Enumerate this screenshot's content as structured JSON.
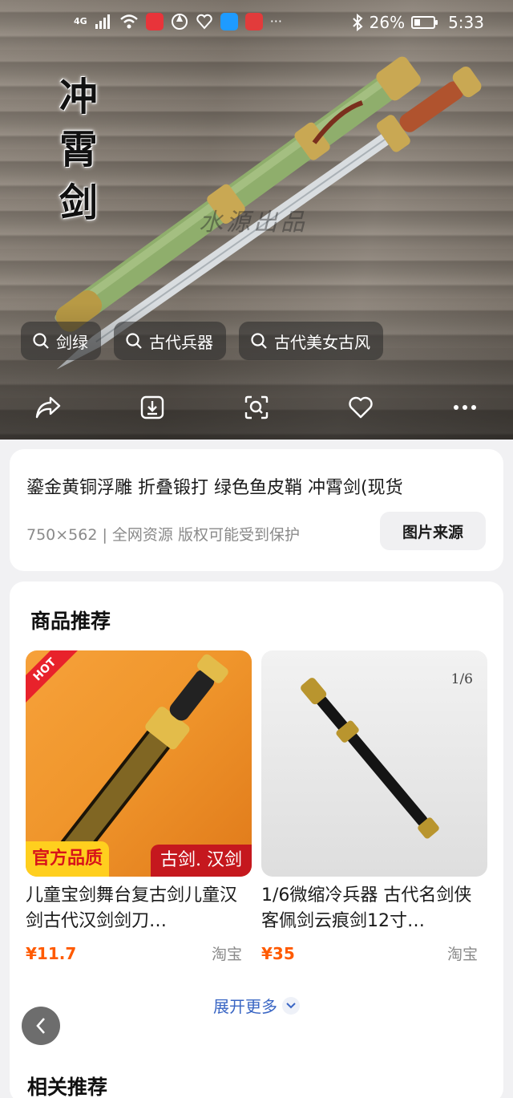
{
  "status_bar": {
    "network": "4G",
    "battery": "26%",
    "time": "5:33",
    "more": "···"
  },
  "hero": {
    "calligraphy": [
      "冲",
      "霄",
      "剑"
    ],
    "watermark": "水源出品",
    "tags": [
      {
        "label": "剑绿"
      },
      {
        "label": "古代兵器"
      },
      {
        "label": "古代美女古风"
      }
    ],
    "actions": [
      "share-icon",
      "download-icon",
      "image-search-icon",
      "heart-icon",
      "more-icon"
    ]
  },
  "info": {
    "title": "鎏金黄铜浮雕 折叠锻打 绿色鱼皮鞘 冲霄剑(现货",
    "meta": "750×562 | 全网资源 版权可能受到保护",
    "source_button": "图片来源"
  },
  "products": {
    "section_title": "商品推荐",
    "items": [
      {
        "name": "儿童宝剑舞台复古剑儿童汉剑古代汉剑剑刀…",
        "price": "¥11.7",
        "shop": "淘宝",
        "badge_hot": "HOT",
        "badge_official": "官方品质",
        "badge_sub": "古剑. 汉剑"
      },
      {
        "name": "1/6微缩冷兵器 古代名剑侠客佩剑云痕剑12寸…",
        "price": "¥35",
        "shop": "淘宝",
        "scale_label": "1/6"
      }
    ],
    "expand": "展开更多"
  },
  "related": {
    "title": "相关推荐"
  },
  "colors": {
    "price": "#ff5a00",
    "link": "#3a66c4",
    "hot": "#e8222b"
  }
}
